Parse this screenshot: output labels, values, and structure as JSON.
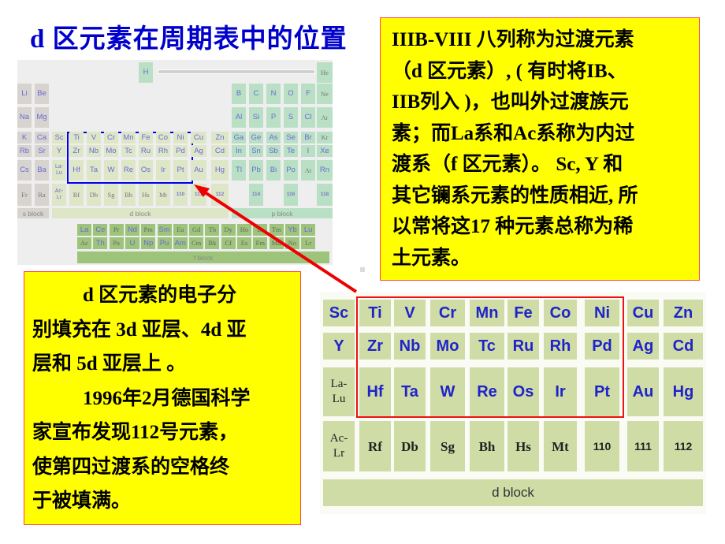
{
  "title": "d 区元素在周期表中的位置",
  "small_table": {
    "h_label": "H",
    "rows": {
      "r1": [
        "Li",
        "Be"
      ],
      "r1_p": [
        "B",
        "C",
        "N",
        "O",
        "F",
        "Ne"
      ],
      "r2": [
        "Na",
        "Mg"
      ],
      "r2_p": [
        "Al",
        "Si",
        "P",
        "S",
        "Cl",
        "Ar"
      ],
      "r3_s": [
        "K",
        "Ca"
      ],
      "r3_d": [
        "Sc",
        "Ti",
        "V",
        "Cr",
        "Mn",
        "Fe",
        "Co",
        "Ni",
        "Cu",
        "Zn"
      ],
      "r3_p": [
        "Ga",
        "Ge",
        "As",
        "Se",
        "Br",
        "Kr"
      ],
      "r4_s": [
        "Rb",
        "Sr"
      ],
      "r4_d": [
        "Y",
        "Zr",
        "Nb",
        "Mo",
        "Tc",
        "Ru",
        "Rh",
        "Pd",
        "Ag",
        "Cd"
      ],
      "r4_p": [
        "In",
        "Sn",
        "Sb",
        "Te",
        "I",
        "Xe"
      ],
      "r5_s": [
        "Cs",
        "Ba"
      ],
      "r5_d": [
        "La-Lu",
        "Hf",
        "Ta",
        "W",
        "Re",
        "Os",
        "Ir",
        "Pt",
        "Au",
        "Hg"
      ],
      "r5_p": [
        "Tl",
        "Pb",
        "Bi",
        "Po",
        "At",
        "Rn"
      ],
      "r6_s": [
        "Fr",
        "Ra"
      ],
      "r6_d": [
        "Ac-Lr",
        "Rf",
        "Db",
        "Sg",
        "Bh",
        "Hs",
        "Mt",
        "110",
        "111",
        "112"
      ],
      "r6_p": [
        "114",
        "116",
        "118"
      ],
      "lanthanides": [
        "La",
        "Ce",
        "Pr",
        "Nd",
        "Pm",
        "Sm",
        "Eu",
        "Gd",
        "Tb",
        "Dy",
        "Ho",
        "Er",
        "Tm",
        "Yb",
        "Lu"
      ],
      "actinides": [
        "Ac",
        "Th",
        "Pa",
        "U",
        "Np",
        "Pu",
        "Am",
        "Cm",
        "Bk",
        "Cf",
        "Es",
        "Fm",
        "Md",
        "No",
        "Lr"
      ]
    },
    "he_label": "He",
    "s_block_label": "s block",
    "d_block_label": "d block",
    "p_block_label": "p block",
    "f_block_label": "f block"
  },
  "right_box": {
    "lines": [
      "IIIB-VIII 八列称为过渡元素",
      "（d 区元素）, ( 有时将IB、",
      "IIB列入 )，也叫外过渡族元",
      "素；而La系和Ac系称为内过",
      "渡系（f 区元素）。 Sc, Y 和",
      "其它镧系元素的性质相近, 所",
      "以常将这17 种元素总称为稀",
      "土元素。"
    ]
  },
  "left_box": {
    "lines": [
      "d 区元素的电子分",
      "别填充在 3d 亚层、4d 亚",
      "层和 5d 亚层上 。",
      "1996年2月德国科学",
      "家宣布发现112号元素，",
      "使第四过渡系的空格终",
      "于被填满。"
    ]
  },
  "d_table": {
    "rows": [
      [
        "Sc",
        "Ti",
        "V",
        "Cr",
        "Mn",
        "Fe",
        "Co",
        "Ni",
        "Cu",
        "Zn"
      ],
      [
        "Y",
        "Zr",
        "Nb",
        "Mo",
        "Tc",
        "Ru",
        "Rh",
        "Pd",
        "Ag",
        "Cd"
      ],
      [
        "La-Lu",
        "Hf",
        "Ta",
        "W",
        "Re",
        "Os",
        "Ir",
        "Pt",
        "Au",
        "Hg"
      ],
      [
        "Ac-Lr",
        "Rf",
        "Db",
        "Sg",
        "Bh",
        "Hs",
        "Mt",
        "110",
        "111",
        "112"
      ]
    ],
    "block_label": "d block"
  },
  "colors": {
    "title": "#0000cc",
    "box_fill": "#ffff00",
    "box_border": "#ff4444",
    "highlight_small": "#0000ee",
    "highlight_large": "#ee1111",
    "arrow": "#ee0000",
    "d_cell": "#cfdca6",
    "element_text": "#1f24c8"
  }
}
